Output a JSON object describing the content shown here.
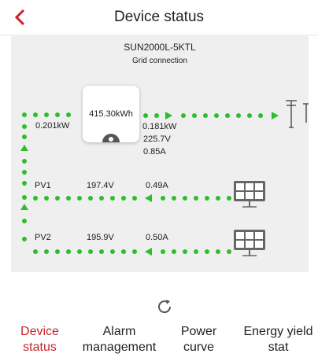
{
  "header": {
    "title": "Device status"
  },
  "device": {
    "model": "SUN2000L-5KTL",
    "connection": "Grid connection",
    "energy": "415.30kWh"
  },
  "flow": {
    "input_power": "0.201kW",
    "output_power": "0.181kW",
    "output_voltage": "225.7V",
    "output_current": "0.85A",
    "pv1": {
      "label": "PV1",
      "voltage": "197.4V",
      "current": "0.49A"
    },
    "pv2": {
      "label": "PV2",
      "voltage": "195.9V",
      "current": "0.50A"
    }
  },
  "tabs": [
    {
      "line1": "Device",
      "line2": "status"
    },
    {
      "line1": "Alarm",
      "line2": "management"
    },
    {
      "line1": "Power",
      "line2": "curve"
    },
    {
      "line1": "Energy yield",
      "line2": "stat"
    }
  ],
  "colors": {
    "accent": "#c8242b",
    "flow": "#2bbf2b"
  }
}
